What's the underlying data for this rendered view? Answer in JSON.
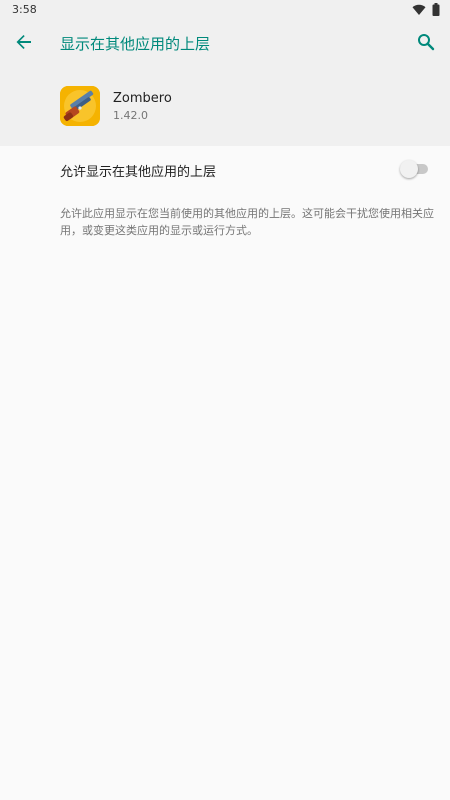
{
  "status_bar": {
    "time": "3:58",
    "icons": [
      "wifi-icon",
      "battery-icon"
    ]
  },
  "app_bar": {
    "title": "显示在其他应用的上层",
    "back_icon": "arrow-back-icon",
    "search_icon": "search-icon",
    "accent_color": "#00897b"
  },
  "app_info": {
    "name": "Zombero",
    "version": "1.42.0",
    "icon": "zombero-app-icon"
  },
  "setting": {
    "label": "允许显示在其他应用的上层",
    "enabled": false
  },
  "description": "允许此应用显示在您当前使用的其他应用的上层。这可能会干扰您使用相关应用，或变更这类应用的显示或运行方式。"
}
